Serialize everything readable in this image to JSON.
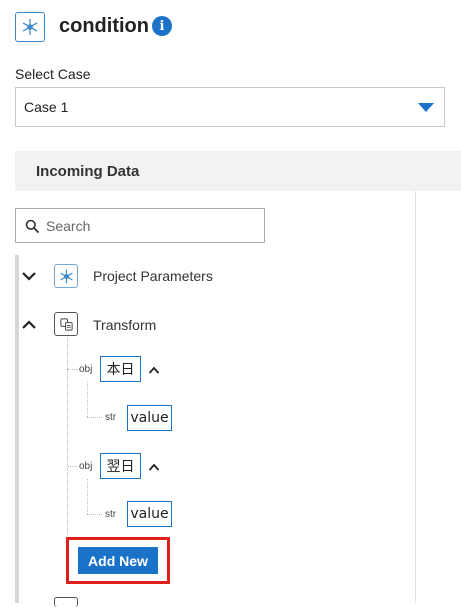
{
  "header": {
    "node_icon": "snowflake-icon",
    "title": "condition",
    "info_icon": "info-icon",
    "info_glyph": "i"
  },
  "case_select": {
    "label": "Select Case",
    "value": "Case 1",
    "caret_icon": "caret-down-icon"
  },
  "incoming": {
    "title": "Incoming Data",
    "search_placeholder": "Search",
    "search_icon": "search-icon"
  },
  "tree": {
    "project_parameters": {
      "label": "Project Parameters",
      "icon": "snowflake-icon",
      "toggle_icon": "chevron-down-icon"
    },
    "transform": {
      "label": "Transform",
      "icon": "transform-icon",
      "toggle_icon": "chevron-up-icon",
      "children": [
        {
          "type": "obj",
          "key": "本日",
          "child_type": "str",
          "child_key": "value"
        },
        {
          "type": "obj",
          "key": "翌日",
          "child_type": "str",
          "child_key": "value"
        }
      ],
      "add_button": "Add New"
    }
  },
  "colors": {
    "accent": "#1a73c8",
    "highlight": "#e0201c",
    "section_bg": "#f2f2f2"
  }
}
